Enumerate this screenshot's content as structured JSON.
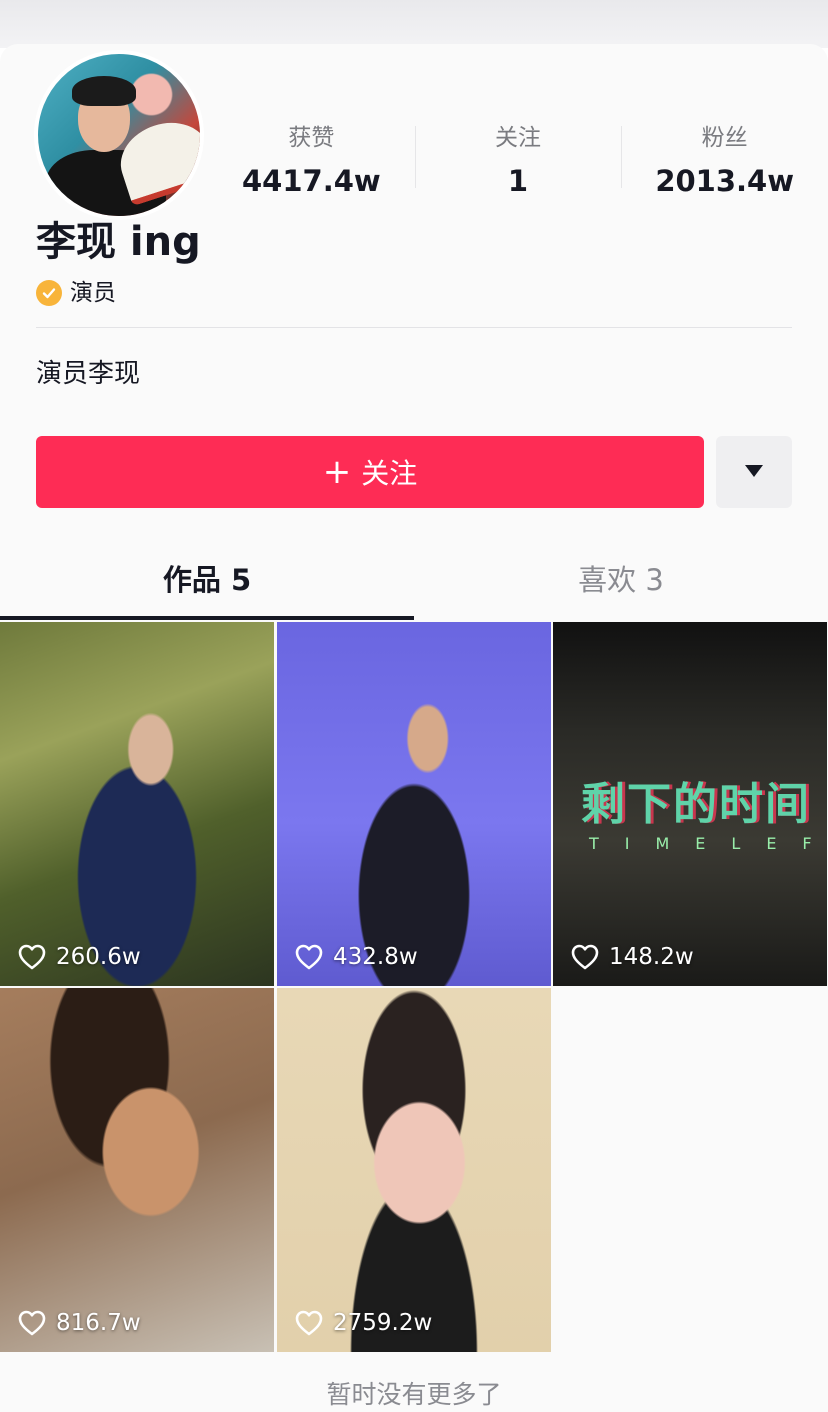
{
  "stats": [
    {
      "label": "获赞",
      "value": "4417.4w"
    },
    {
      "label": "关注",
      "value": "1"
    },
    {
      "label": "粉丝",
      "value": "2013.4w"
    }
  ],
  "profile": {
    "name": "李现 ing",
    "verified_label": "演员",
    "bio": "演员李现"
  },
  "actions": {
    "follow_label": "关注",
    "follow_color": "#fe2c55"
  },
  "tabs": [
    {
      "label": "作品 5",
      "active": true
    },
    {
      "label": "喜欢 3",
      "active": false
    }
  ],
  "videos": [
    {
      "likes": "260.6w"
    },
    {
      "likes": "432.8w"
    },
    {
      "likes": "148.2w",
      "overlay_title": "剩下的时间",
      "overlay_sub": "TIMELEFT"
    },
    {
      "likes": "816.7w"
    },
    {
      "likes": "2759.2w"
    }
  ],
  "footer": {
    "text": "暂时没有更多了"
  }
}
